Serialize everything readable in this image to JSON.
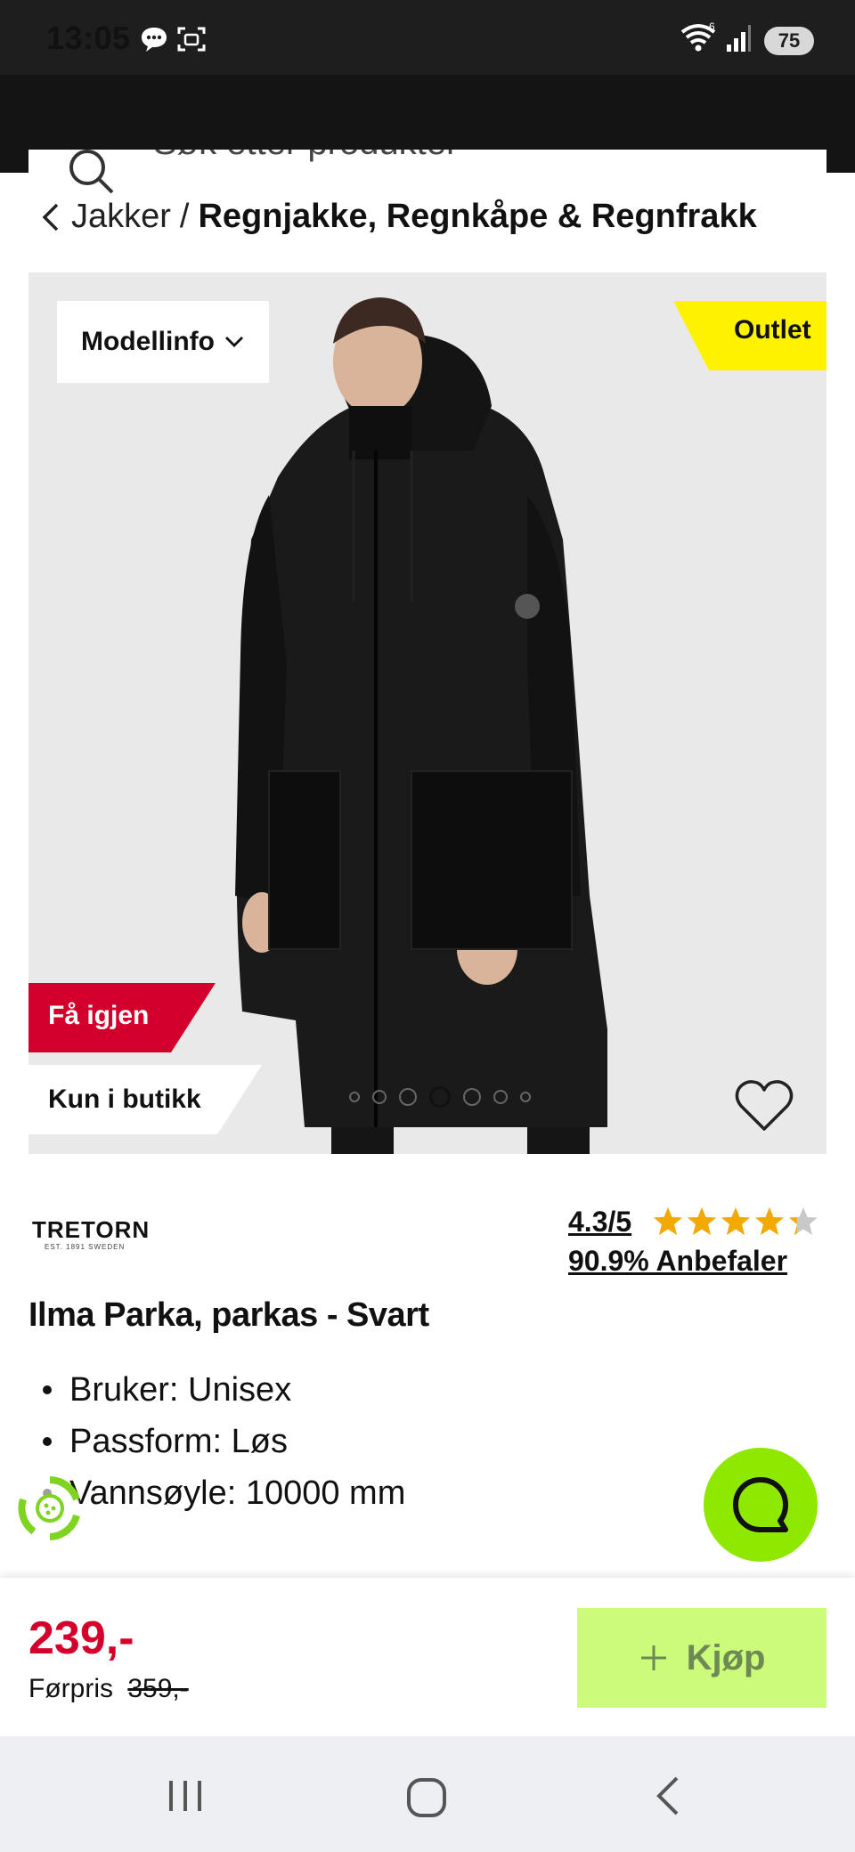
{
  "status_bar": {
    "time": "13:05",
    "battery": "75",
    "wifi_badge": "6"
  },
  "search": {
    "placeholder": "Søk etter produkter"
  },
  "breadcrumb": {
    "parent": "Jakker",
    "separator": "/",
    "current": "Regnjakke, Regnkåpe & Regnfrakk"
  },
  "image_panel": {
    "model_info_label": "Modellinfo",
    "outlet_badge": "Outlet",
    "get_back_badge": "Få igjen",
    "store_only_badge": "Kun i butikk",
    "carousel_total": 7,
    "carousel_active_index": 3,
    "colors": {
      "outlet": "#fff200",
      "get_back": "#d4002c"
    }
  },
  "product": {
    "brand": "TRETORN",
    "brand_tagline": "EST. 1891 SWEDEN",
    "rating_text": "4.3/5",
    "rating_value": 4.3,
    "rating_max": 5,
    "recommend_text": "90.9% Anbefaler",
    "title": "Ilma Parka, parkas - Svart",
    "features": [
      "Bruker: Unisex",
      "Passform: Løs",
      "Vannsøyle: 10000 mm"
    ]
  },
  "buy_bar": {
    "price": "239,-",
    "previous_price_label": "Førpris",
    "previous_price": "359,-",
    "buy_label": "Kjøp",
    "colors": {
      "price": "#d4002c",
      "buy_button": "#ccfa7a"
    }
  },
  "icons": {
    "chat_fab": "chat-bubble-icon",
    "eco": "recycle-icon",
    "favorite": "heart-icon"
  }
}
